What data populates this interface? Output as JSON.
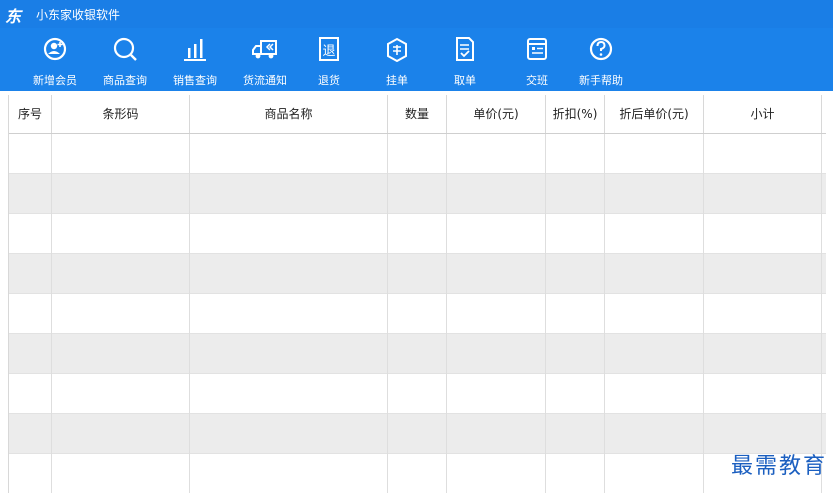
{
  "app": {
    "logo": "东",
    "title": "小东家收银软件"
  },
  "toolbar": {
    "items": [
      {
        "label": "新增会员",
        "icon": "member-add-icon"
      },
      {
        "label": "商品查询",
        "icon": "search-icon"
      },
      {
        "label": "销售查询",
        "icon": "bar-chart-icon"
      },
      {
        "label": "货流通知",
        "icon": "delivery-truck-icon"
      },
      {
        "label": "退货",
        "icon": "return-goods-icon"
      },
      {
        "label": "挂单",
        "icon": "hang-order-icon"
      },
      {
        "label": "取单",
        "icon": "retrieve-order-icon"
      },
      {
        "label": "交班",
        "icon": "shift-handover-icon"
      },
      {
        "label": "新手帮助",
        "icon": "help-icon"
      }
    ]
  },
  "table": {
    "columns": [
      "序号",
      "条形码",
      "商品名称",
      "数量",
      "单价(元)",
      "折扣(%)",
      "折后单价(元)",
      "小计"
    ],
    "rows": 9
  },
  "watermark": "最需教育",
  "colors": {
    "titlebar": "#1a7ee6",
    "toolbar": "#1b82ea",
    "alt_row": "#ececec"
  }
}
